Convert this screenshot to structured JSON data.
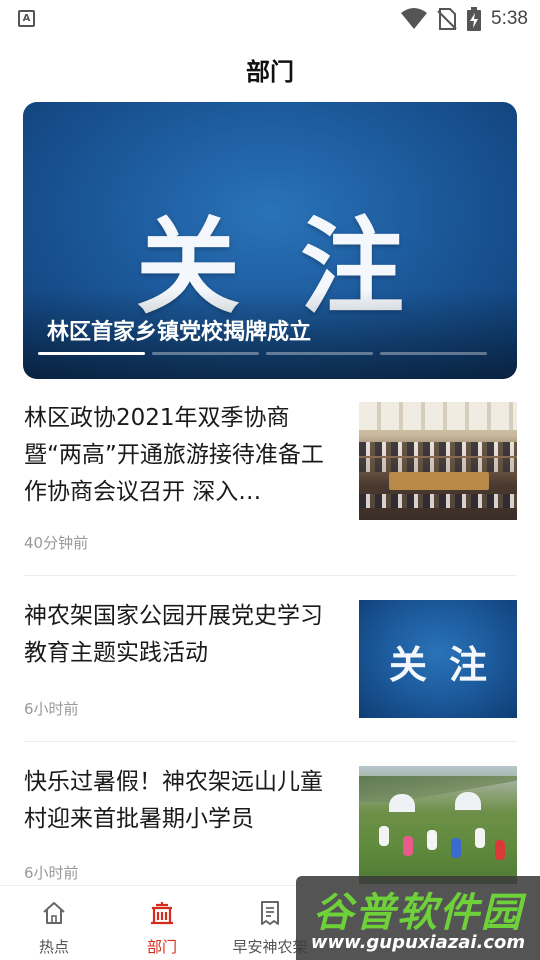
{
  "status_bar": {
    "notification_icon": "a-icon",
    "time": "5:38"
  },
  "header": {
    "title": "部门"
  },
  "banner": {
    "image_text": "关注",
    "caption": "林区首家乡镇党校揭牌成立",
    "slide_count": 4,
    "active_slide": 1
  },
  "news": [
    {
      "title": "林区政协2021年双季协商暨“两高”开通旅游接待准备工作协商会议召开 深入…",
      "time": "40分钟前",
      "thumb": "meeting-photo"
    },
    {
      "title": "神农架国家公园开展党史学习教育主题实践活动",
      "time": "6小时前",
      "thumb_text": "关注"
    },
    {
      "title": "快乐过暑假！神农架远山儿童村迎来首批暑期小学员",
      "time": "6小时前",
      "thumb": "camp-photo"
    }
  ],
  "bottom_nav": {
    "items": [
      {
        "label": "热点",
        "icon": "home-icon",
        "active": false
      },
      {
        "label": "部门",
        "icon": "building-icon",
        "active": true
      },
      {
        "label": "早安神农架",
        "icon": "document-icon",
        "active": false
      }
    ]
  },
  "watermark": {
    "main": "谷普软件园",
    "url": "www.gupuxiazai.com"
  },
  "colors": {
    "accent": "#d52b1e",
    "banner_blue": "#1c5a9c",
    "watermark_green": "#6fd13a"
  }
}
